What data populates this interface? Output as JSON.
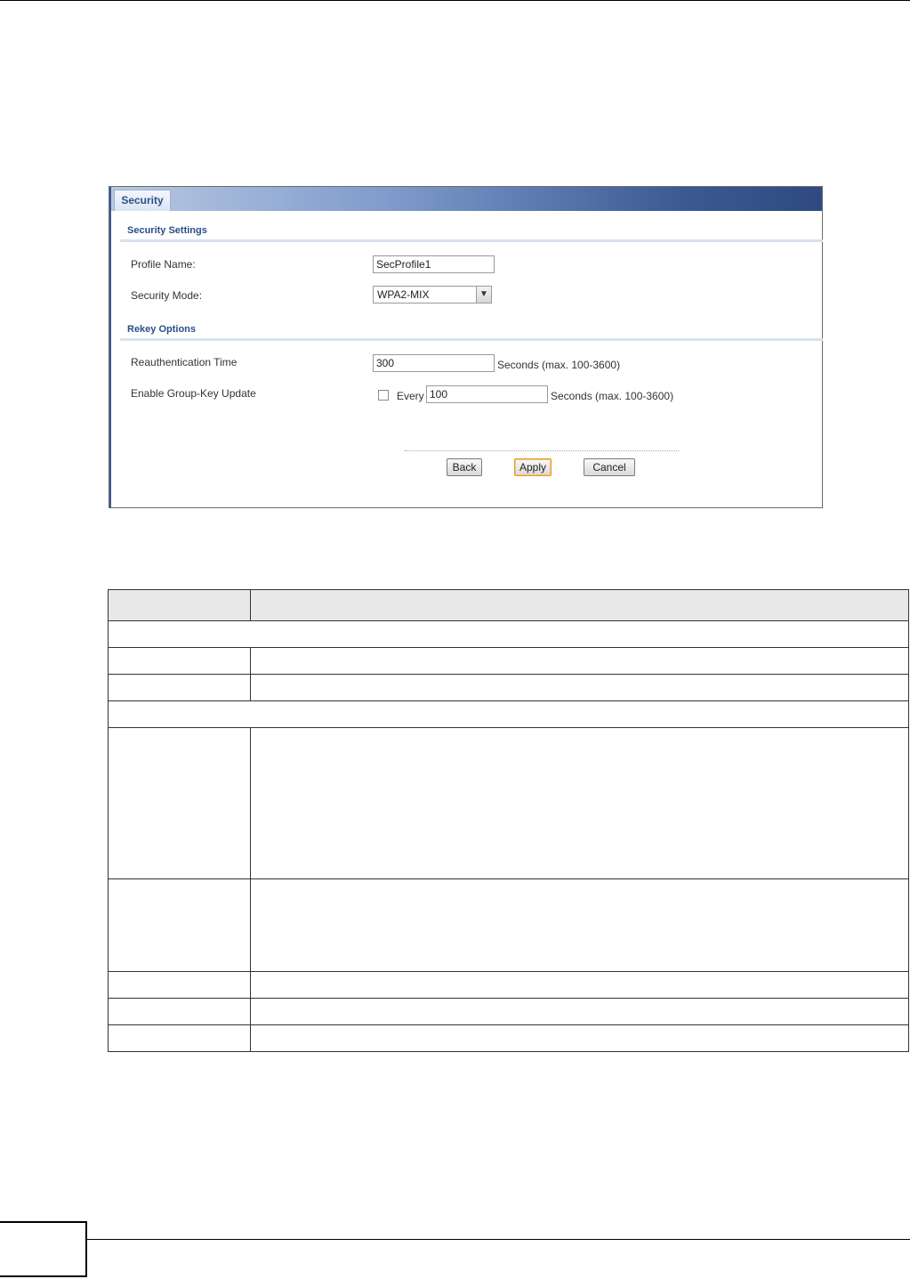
{
  "panel": {
    "tab_label": "Security",
    "security_settings": {
      "title": "Security Settings",
      "profile_name_label": "Profile Name:",
      "profile_name_value": "SecProfile1",
      "security_mode_label": "Security Mode:",
      "security_mode_value": "WPA2-MIX"
    },
    "rekey_options": {
      "title": "Rekey Options",
      "reauth_label": "Reauthentication Time",
      "reauth_value": "300",
      "reauth_suffix": "Seconds (max. 100-3600)",
      "group_key_label": "Enable Group-Key Update",
      "group_key_checked": false,
      "every_label": "Every",
      "group_key_value": "100",
      "group_key_suffix": "Seconds (max. 100-3600)"
    },
    "buttons": {
      "back": "Back",
      "apply": "Apply",
      "cancel": "Cancel"
    }
  },
  "table": {
    "header": [
      "",
      ""
    ],
    "rows": [
      {
        "type": "section",
        "text": ""
      },
      {
        "type": "row",
        "label": "",
        "desc": ""
      },
      {
        "type": "row",
        "label": "",
        "desc": ""
      },
      {
        "type": "section",
        "text": ""
      },
      {
        "type": "row-tall",
        "label": "",
        "desc": ""
      },
      {
        "type": "row-mid",
        "label": "",
        "desc": ""
      },
      {
        "type": "row",
        "label": "",
        "desc": ""
      },
      {
        "type": "row",
        "label": "",
        "desc": ""
      },
      {
        "type": "row",
        "label": "",
        "desc": ""
      }
    ]
  },
  "colors": {
    "accent": "#2a4f87",
    "header_gradient_end": "#2e4a80",
    "apply_border": "#e29a2b"
  }
}
